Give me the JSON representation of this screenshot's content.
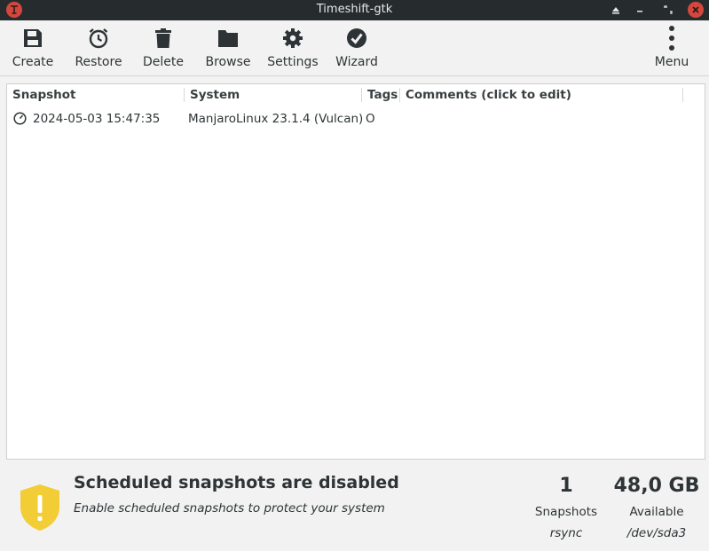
{
  "window": {
    "title": "Timeshift-gtk"
  },
  "toolbar": {
    "create": "Create",
    "restore": "Restore",
    "delete": "Delete",
    "browse": "Browse",
    "settings": "Settings",
    "wizard": "Wizard",
    "menu": "Menu"
  },
  "table": {
    "columns": [
      "Snapshot",
      "System",
      "Tags",
      "Comments (click to edit)"
    ],
    "rows": [
      {
        "snapshot": "2024-05-03 15:47:35",
        "system": "ManjaroLinux 23.1.4 (Vulcan)",
        "tags": "O",
        "comments": ""
      }
    ]
  },
  "status": {
    "title": "Scheduled snapshots are disabled",
    "subtitle": "Enable scheduled snapshots to protect your system",
    "snapshots_count": "1",
    "snapshots_label": "Snapshots",
    "snapshot_type": "rsync",
    "available_size": "48,0 GB",
    "available_label": "Available",
    "device": "/dev/sda3"
  },
  "colors": {
    "titlebar_bg": "#262c2e",
    "close_button": "#d4473d",
    "shield_yellow": "#f2cd36",
    "icon_dark": "#2e3436"
  },
  "icons": {
    "create": "save-icon",
    "restore": "clock-icon",
    "delete": "trash-icon",
    "browse": "folder-icon",
    "settings": "gear-icon",
    "wizard": "check-circle-icon",
    "menu": "kebab-menu-icon",
    "snapshot_row": "clock-icon",
    "status": "warning-shield-icon"
  }
}
